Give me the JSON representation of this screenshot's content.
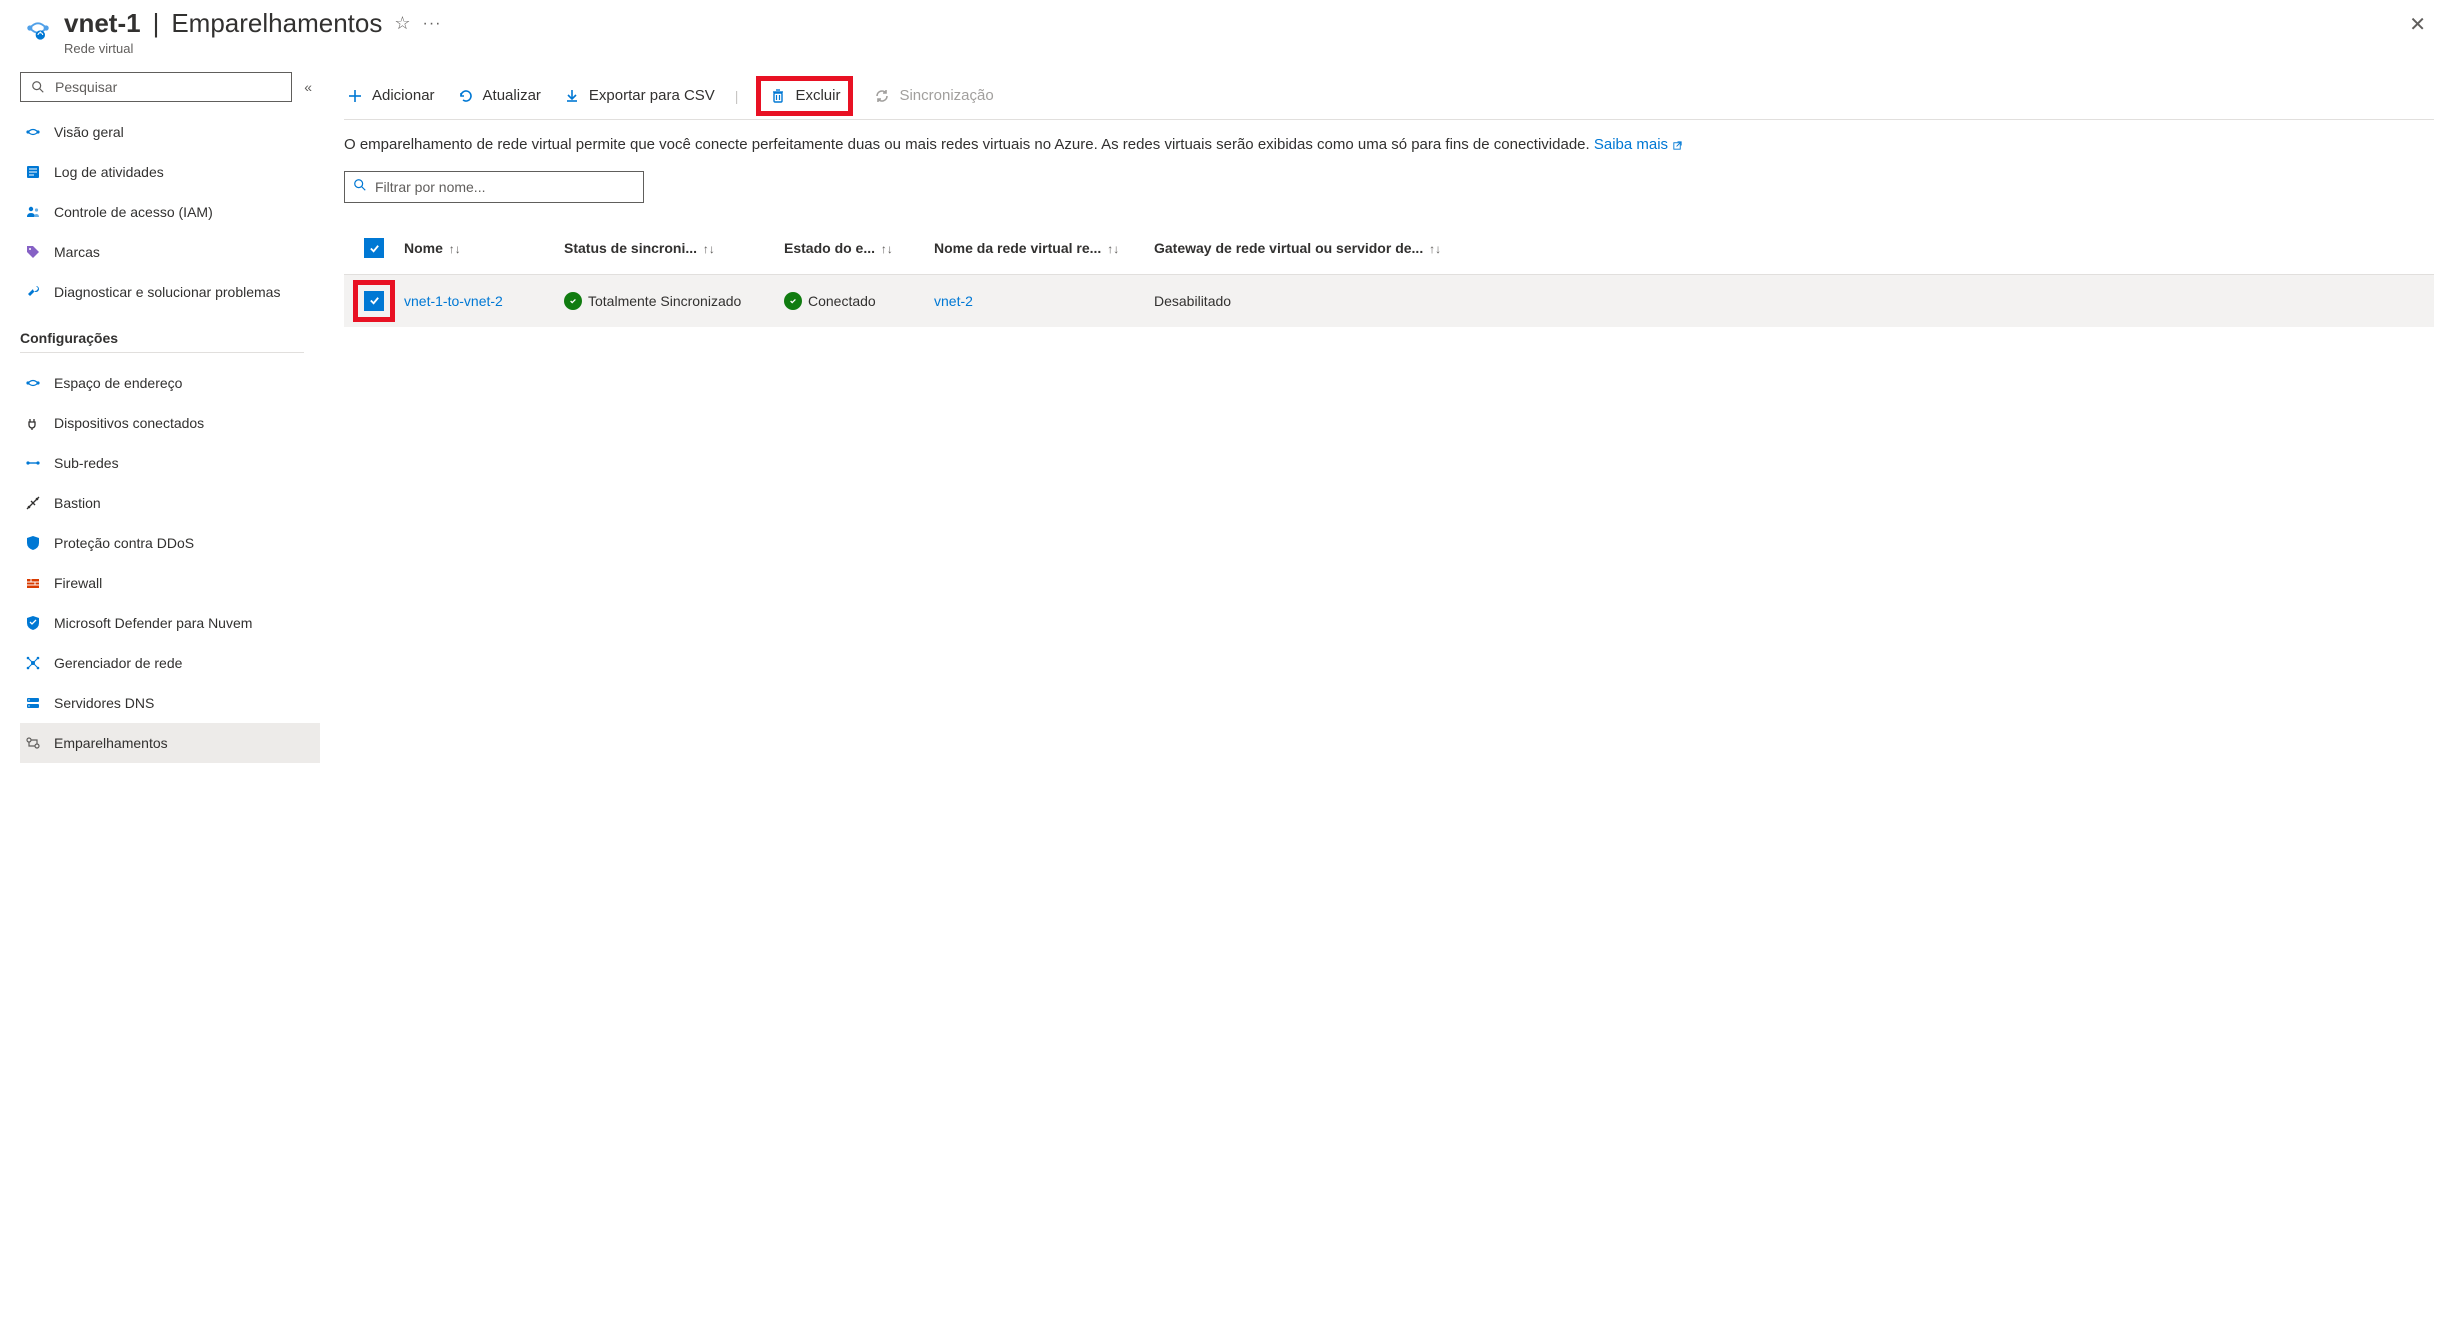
{
  "header": {
    "title": "vnet-1",
    "subtitle_section": "Emparelhamentos",
    "resource_type": "Rede virtual"
  },
  "sidebar": {
    "search_placeholder": "Pesquisar",
    "items_top": [
      {
        "label": "Visão geral"
      },
      {
        "label": "Log de atividades"
      },
      {
        "label": "Controle de acesso (IAM)"
      },
      {
        "label": "Marcas"
      },
      {
        "label": "Diagnosticar e solucionar problemas"
      }
    ],
    "section_title": "Configurações",
    "items_settings": [
      {
        "label": "Espaço de endereço"
      },
      {
        "label": "Dispositivos conectados"
      },
      {
        "label": "Sub-redes"
      },
      {
        "label": "Bastion"
      },
      {
        "label": "Proteção contra DDoS"
      },
      {
        "label": "Firewall"
      },
      {
        "label": "Microsoft Defender para Nuvem"
      },
      {
        "label": "Gerenciador de rede"
      },
      {
        "label": "Servidores DNS"
      },
      {
        "label": "Emparelhamentos"
      }
    ]
  },
  "toolbar": {
    "add": "Adicionar",
    "refresh": "Atualizar",
    "export": "Exportar para CSV",
    "delete": "Excluir",
    "sync": "Sincronização"
  },
  "description": {
    "text": "O emparelhamento de rede virtual permite que você conecte perfeitamente duas ou mais redes virtuais no Azure. As redes virtuais serão exibidas como uma só para fins de conectividade. ",
    "learn_more": "Saiba mais"
  },
  "filter": {
    "placeholder": "Filtrar por nome..."
  },
  "table": {
    "headers": {
      "name": "Nome",
      "sync": "Status de sincroni...",
      "state": "Estado do e...",
      "remote": "Nome da rede virtual re...",
      "gateway": "Gateway de rede virtual ou servidor de..."
    },
    "rows": [
      {
        "name": "vnet-1-to-vnet-2",
        "sync": "Totalmente Sincronizado",
        "state": "Conectado",
        "remote": "vnet-2",
        "gateway": "Desabilitado"
      }
    ]
  }
}
